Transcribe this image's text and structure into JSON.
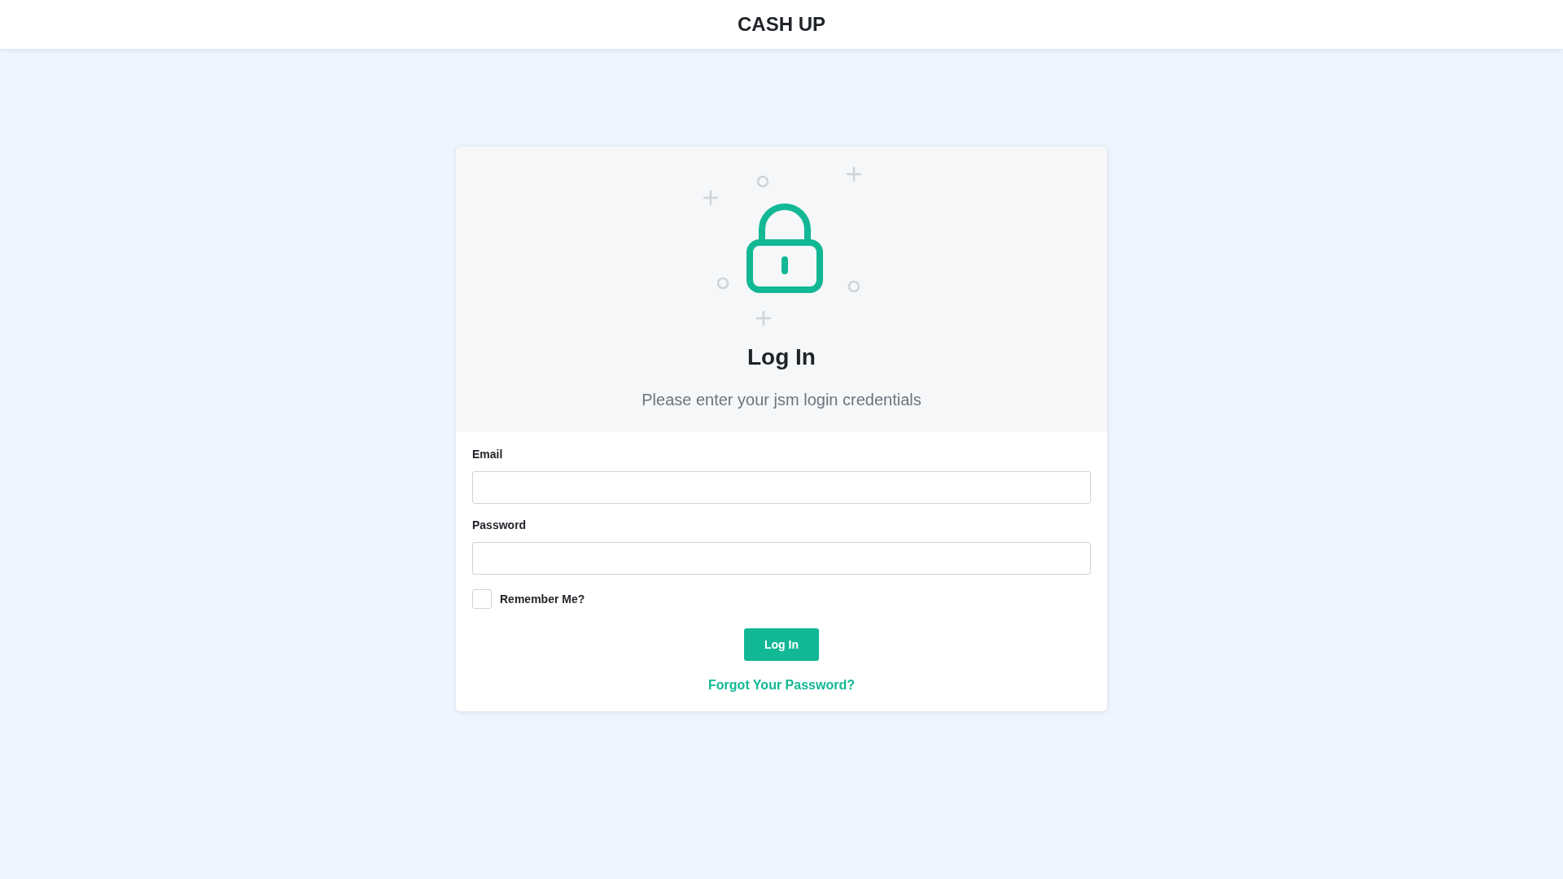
{
  "header": {
    "title": "CASH UP"
  },
  "login": {
    "title": "Log In",
    "subtitle": "Please enter your jsm login credentials",
    "fields": [
      {
        "label": "Email"
      },
      {
        "label": "Password"
      }
    ],
    "remember": {
      "label": "Remember Me?",
      "checked": false
    },
    "button": "Log In",
    "link": "Forgot Your Password?"
  }
}
